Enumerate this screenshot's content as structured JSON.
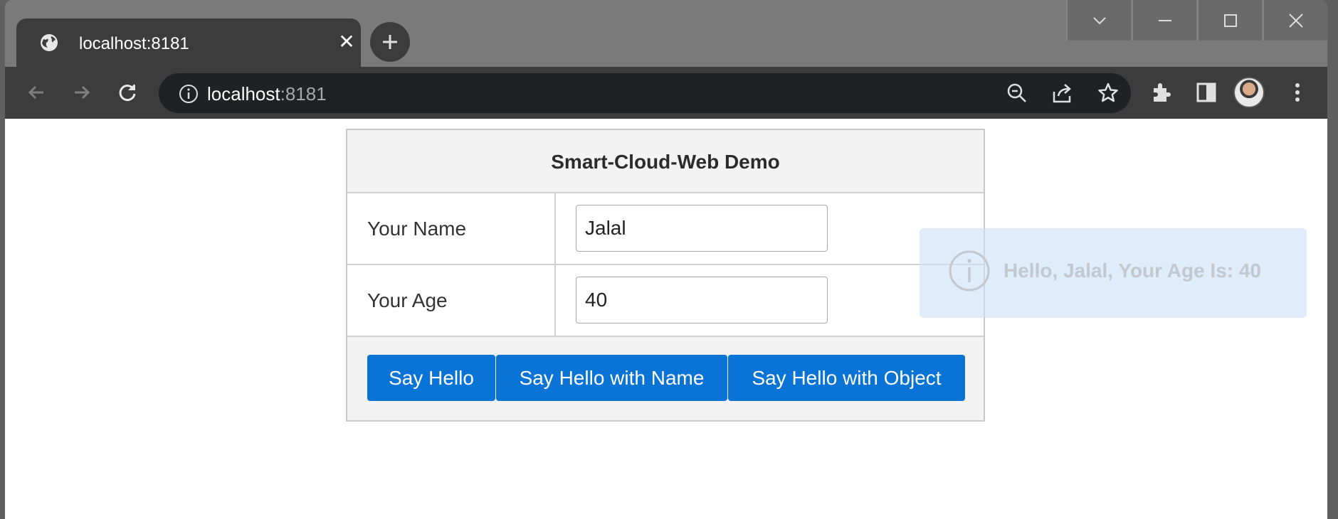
{
  "browser": {
    "tab_title": "localhost:8181",
    "url_host": "localhost",
    "url_port": ":8181"
  },
  "page": {
    "title": "Smart-Cloud-Web Demo",
    "name_label": "Your Name",
    "name_value": "Jalal",
    "age_label": "Your Age",
    "age_value": "40",
    "buttons": {
      "say_hello": "Say Hello",
      "say_hello_name": "Say Hello with Name",
      "say_hello_object": "Say Hello with Object"
    },
    "toast_message": "Hello, Jalal, Your Age Is: 40"
  },
  "colors": {
    "primary_button": "#0a74d6",
    "toast_background": "#cce1f5",
    "chrome_dark": "#3c3c3c"
  },
  "icons": {
    "tab_favicon": "globe-icon",
    "toast": "info-circle-icon"
  }
}
